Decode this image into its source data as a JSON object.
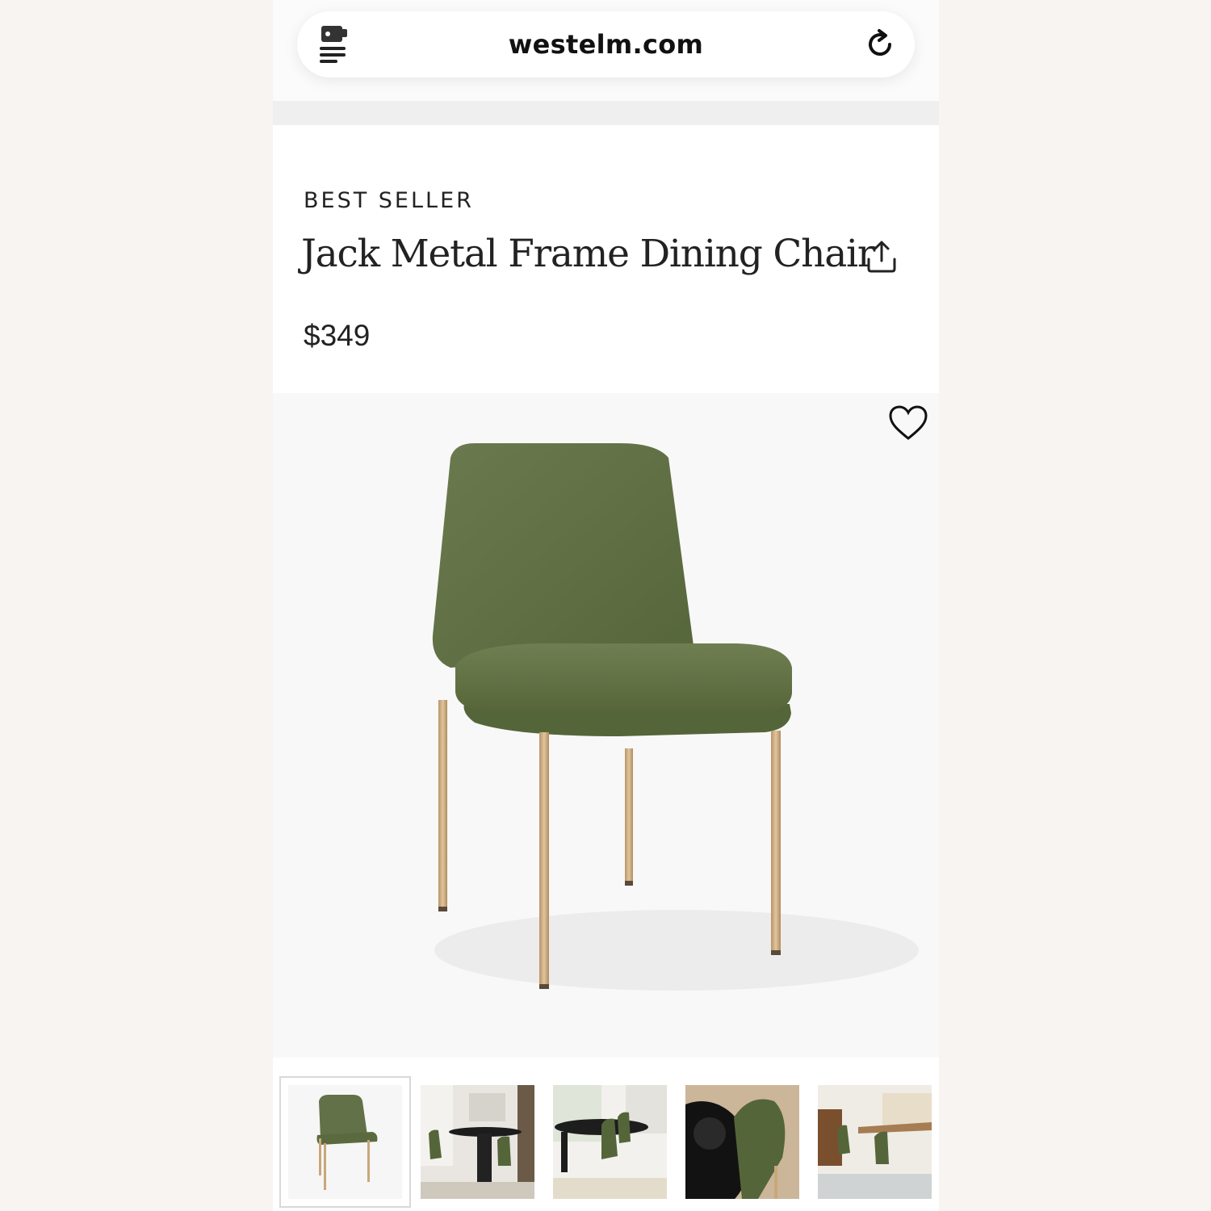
{
  "browser": {
    "url": "westelm.com",
    "reader_icon": "reader-mode-icon",
    "reload_icon": "reload-icon"
  },
  "product": {
    "badge": "BEST SELLER",
    "title": "Jack Metal Frame Dining Chair",
    "price": "$349",
    "share_icon": "share-icon",
    "favorite_icon": "heart-icon"
  },
  "gallery": {
    "selected_index": 0,
    "thumbnail_count": 5
  },
  "colors": {
    "upholstery": "#5f6f43",
    "legs": "#c9a77a",
    "text": "#222222"
  }
}
